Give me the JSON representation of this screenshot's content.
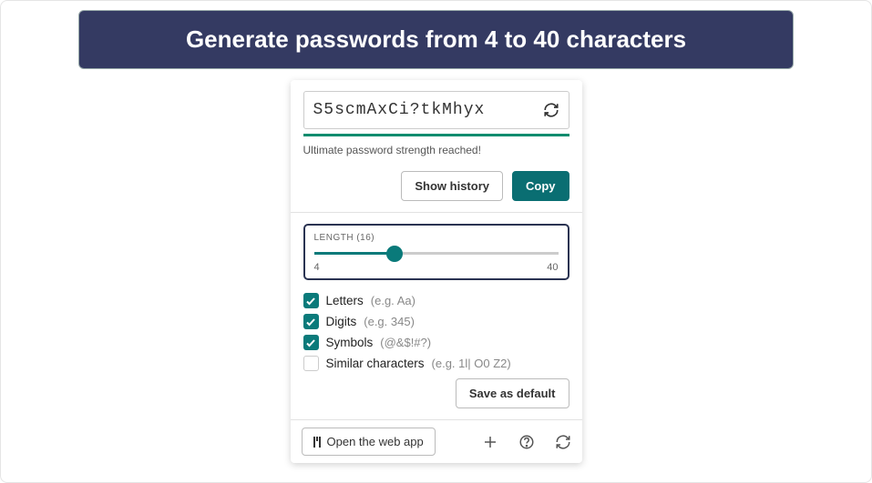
{
  "banner": {
    "title": "Generate passwords from 4 to 40 characters"
  },
  "generator": {
    "password": "S5scmAxCi?tkMhyx",
    "strength_label": "Ultimate password strength reached!",
    "show_history_label": "Show history",
    "copy_label": "Copy"
  },
  "length": {
    "label": "LENGTH (16)",
    "value": 16,
    "min": "4",
    "max": "40"
  },
  "options": {
    "letters": {
      "label": "Letters",
      "hint": "(e.g. Aa)",
      "checked": true
    },
    "digits": {
      "label": "Digits",
      "hint": "(e.g. 345)",
      "checked": true
    },
    "symbols": {
      "label": "Symbols",
      "hint": "(@&$!#?)",
      "checked": true
    },
    "similar": {
      "label": "Similar characters",
      "hint": "(e.g. 1l| O0 Z2)",
      "checked": false
    }
  },
  "save_default_label": "Save as default",
  "footer": {
    "open_web_label": "Open the web app"
  }
}
